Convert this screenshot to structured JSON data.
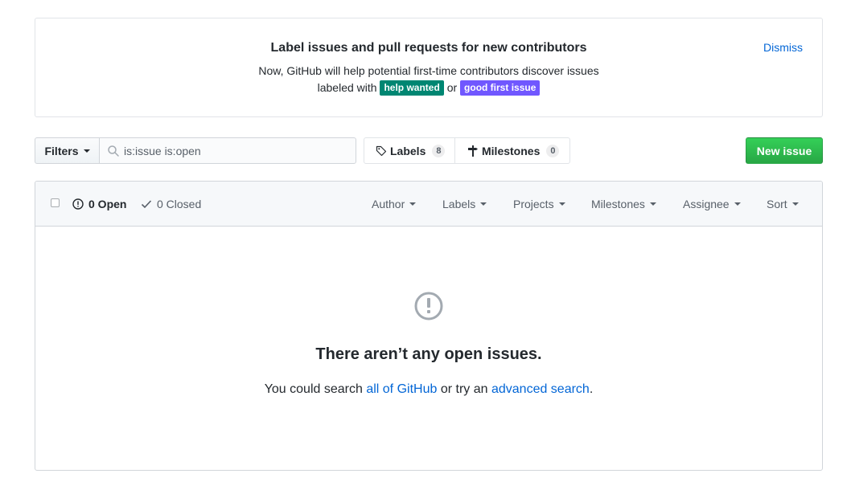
{
  "banner": {
    "title": "Label issues and pull requests for new contributors",
    "text_1": "Now, GitHub will help potential first-time contributors discover issues",
    "text_2": "labeled with",
    "label_help": "help wanted",
    "label_help_color": "#008672",
    "or_text": "or",
    "label_good": "good first issue",
    "label_good_color": "#7057ff",
    "dismiss": "Dismiss"
  },
  "toolbar": {
    "filters_label": "Filters",
    "search_value": "is:issue is:open",
    "labels_label": "Labels",
    "labels_count": "8",
    "milestones_label": "Milestones",
    "milestones_count": "0",
    "new_issue_label": "New issue"
  },
  "issues_header": {
    "open_label": "0 Open",
    "closed_label": "0 Closed",
    "filters": [
      "Author",
      "Labels",
      "Projects",
      "Milestones",
      "Assignee",
      "Sort"
    ]
  },
  "blankslate": {
    "title": "There aren’t any open issues.",
    "text_prefix": "You could search",
    "link_1": "all of GitHub",
    "text_middle": "or try an",
    "link_2": "advanced search",
    "text_suffix": "."
  },
  "colors": {
    "link": "#0366d6",
    "primary_button": "#28a745",
    "border": "#d1d5da"
  },
  "icons": [
    "search-icon",
    "tag-icon",
    "milestone-icon",
    "issue-opened-icon",
    "check-icon",
    "caret-down-icon"
  ]
}
